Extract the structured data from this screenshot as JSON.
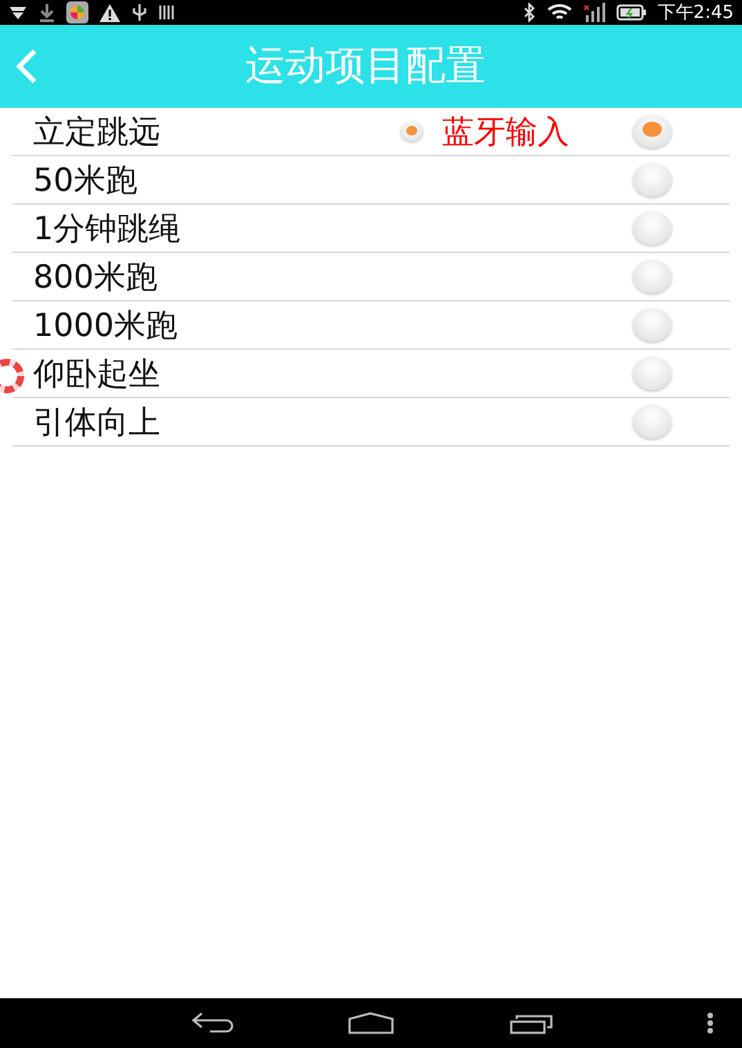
{
  "status_bar": {
    "time": "下午2:45"
  },
  "header": {
    "title": "运动项目配置"
  },
  "items": [
    {
      "label": "立定跳远",
      "selected": true,
      "option": {
        "label": "蓝牙输入",
        "selected": true
      }
    },
    {
      "label": "50米跑",
      "selected": false
    },
    {
      "label": "1分钟跳绳",
      "selected": false
    },
    {
      "label": "800米跑",
      "selected": false
    },
    {
      "label": "1000米跑",
      "selected": false
    },
    {
      "label": "仰卧起坐",
      "selected": false
    },
    {
      "label": "引体向上",
      "selected": false
    }
  ]
}
